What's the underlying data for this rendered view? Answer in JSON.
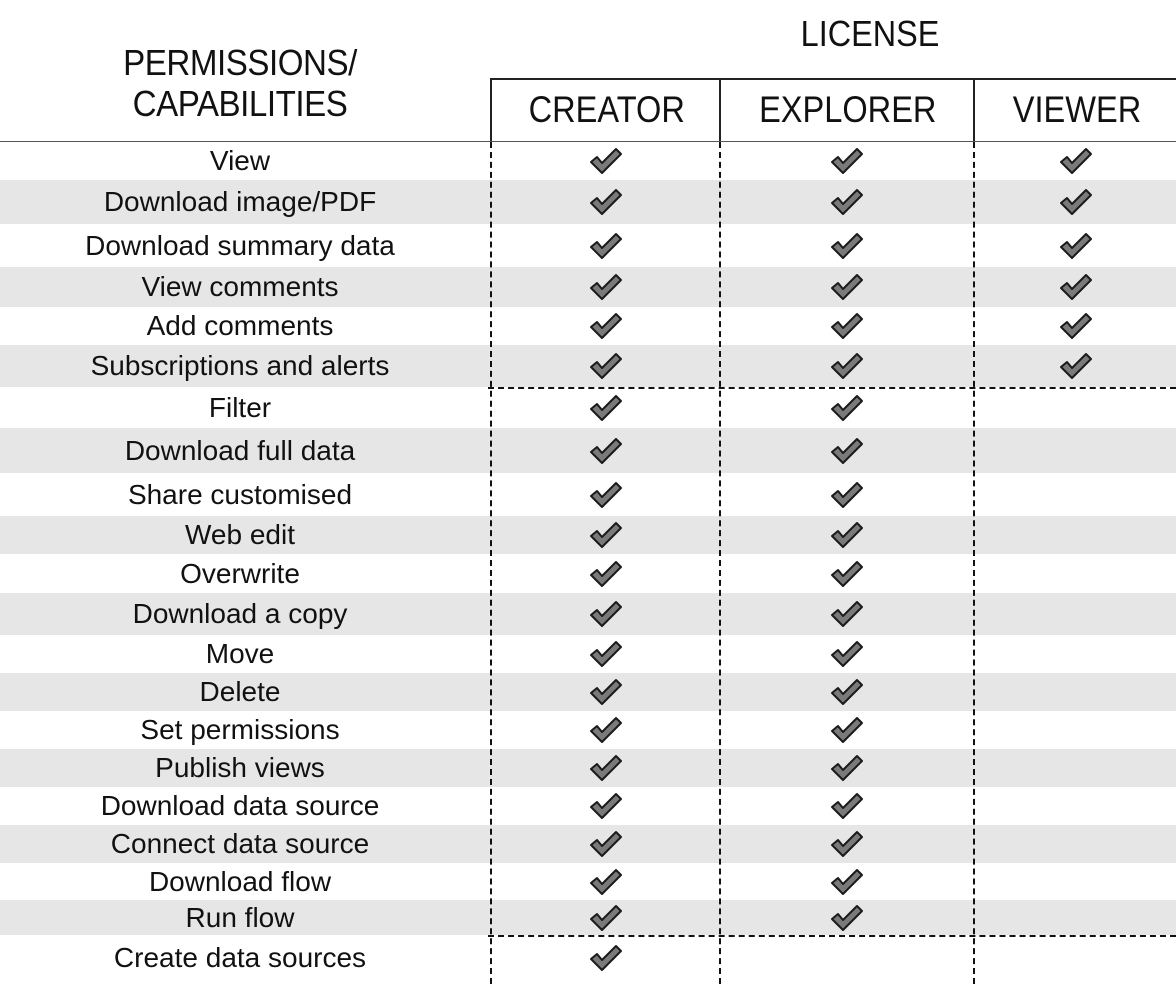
{
  "header": {
    "row_header_line1": "PERMISSIONS/",
    "row_header_line2": "CAPABILITIES",
    "group_header": "LICENSE",
    "columns": [
      "CREATOR",
      "EXPLORER",
      "VIEWER"
    ]
  },
  "icons": {
    "granted": "checkmark-icon"
  },
  "colors": {
    "check_fill": "#7a7a7a",
    "stripe": "#e6e6e6",
    "border": "#111111"
  },
  "rows": [
    {
      "label": "View",
      "creator": true,
      "explorer": true,
      "viewer": true
    },
    {
      "label": "Download image/PDF",
      "creator": true,
      "explorer": true,
      "viewer": true
    },
    {
      "label": "Download summary data",
      "creator": true,
      "explorer": true,
      "viewer": true
    },
    {
      "label": "View comments",
      "creator": true,
      "explorer": true,
      "viewer": true
    },
    {
      "label": "Add comments",
      "creator": true,
      "explorer": true,
      "viewer": true
    },
    {
      "label": "Subscriptions and alerts",
      "creator": true,
      "explorer": true,
      "viewer": true
    },
    {
      "label": "Filter",
      "creator": true,
      "explorer": true,
      "viewer": false
    },
    {
      "label": "Download full data",
      "creator": true,
      "explorer": true,
      "viewer": false
    },
    {
      "label": "Share customised",
      "creator": true,
      "explorer": true,
      "viewer": false
    },
    {
      "label": "Web edit",
      "creator": true,
      "explorer": true,
      "viewer": false
    },
    {
      "label": "Overwrite",
      "creator": true,
      "explorer": true,
      "viewer": false
    },
    {
      "label": "Download a copy",
      "creator": true,
      "explorer": true,
      "viewer": false
    },
    {
      "label": "Move",
      "creator": true,
      "explorer": true,
      "viewer": false
    },
    {
      "label": "Delete",
      "creator": true,
      "explorer": true,
      "viewer": false
    },
    {
      "label": "Set permissions",
      "creator": true,
      "explorer": true,
      "viewer": false
    },
    {
      "label": "Publish views",
      "creator": true,
      "explorer": true,
      "viewer": false
    },
    {
      "label": "Download data source",
      "creator": true,
      "explorer": true,
      "viewer": false
    },
    {
      "label": "Connect data source",
      "creator": true,
      "explorer": true,
      "viewer": false
    },
    {
      "label": "Download flow",
      "creator": true,
      "explorer": true,
      "viewer": false
    },
    {
      "label": "Run flow",
      "creator": true,
      "explorer": true,
      "viewer": false
    },
    {
      "label": "Create data sources",
      "creator": true,
      "explorer": false,
      "viewer": false
    }
  ]
}
